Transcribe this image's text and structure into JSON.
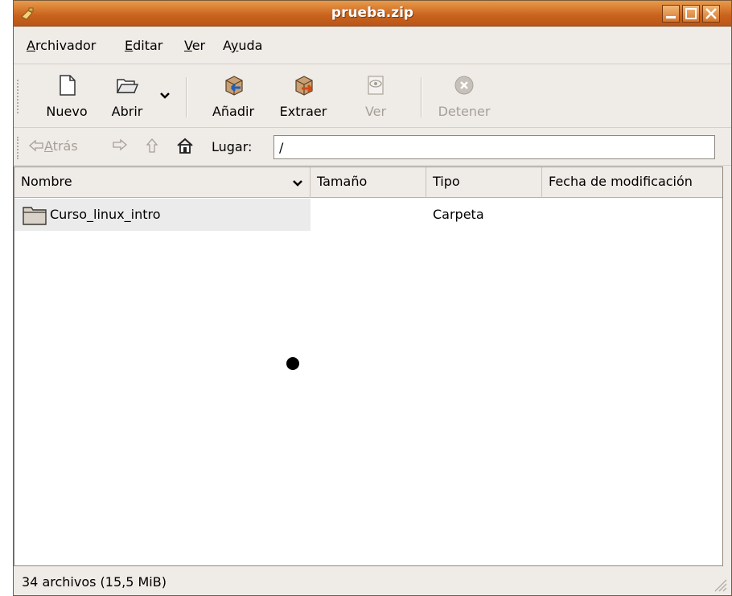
{
  "window": {
    "title": "prueba.zip"
  },
  "menubar": {
    "items": [
      {
        "pre": "",
        "key": "A",
        "post": "rchivador"
      },
      {
        "pre": "",
        "key": "E",
        "post": "ditar"
      },
      {
        "pre": "",
        "key": "V",
        "post": "er"
      },
      {
        "pre": "A",
        "key": "y",
        "post": "uda"
      }
    ]
  },
  "toolbar": {
    "nuevo": "Nuevo",
    "abrir": "Abrir",
    "anadir": "Añadir",
    "extraer": "Extraer",
    "ver": "Ver",
    "detener": "Detener"
  },
  "locationbar": {
    "back_key": "A",
    "back_rest": "trás",
    "lugar_label": "Lugar:",
    "location_value": "/"
  },
  "filelist": {
    "columns": [
      "Nombre",
      "Tamaño",
      "Tipo",
      "Fecha de modificación"
    ],
    "rows": [
      {
        "name": "Curso_linux_intro",
        "size": "",
        "type": "Carpeta",
        "modified": ""
      }
    ]
  },
  "status": {
    "text": "34 archivos (15,5 MiB)"
  },
  "colors": {
    "titlebar": "#c8621c",
    "window_bg": "#efebe7",
    "selection": "#ebebeb"
  }
}
